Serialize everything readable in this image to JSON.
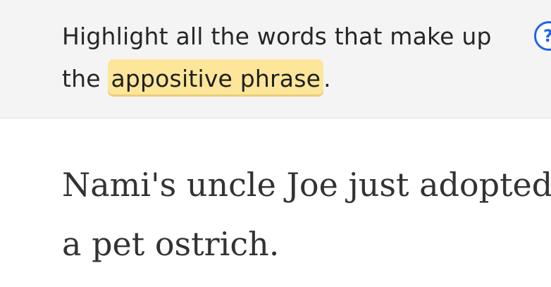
{
  "prompt": {
    "before_highlight_line1": "Highlight all the words that make up",
    "before_highlight_line2": "the ",
    "highlighted_term": "appositive phrase",
    "after_highlight": "."
  },
  "help_button": {
    "label": "?"
  },
  "passage": {
    "words": [
      "Nami's",
      "uncle",
      "Joe",
      "just",
      "adopted",
      "a",
      "pet",
      "ostrich."
    ]
  },
  "colors": {
    "highlight": "#fde69a",
    "help_blue": "#1f63e6",
    "panel_background": "#f4f4f5"
  }
}
